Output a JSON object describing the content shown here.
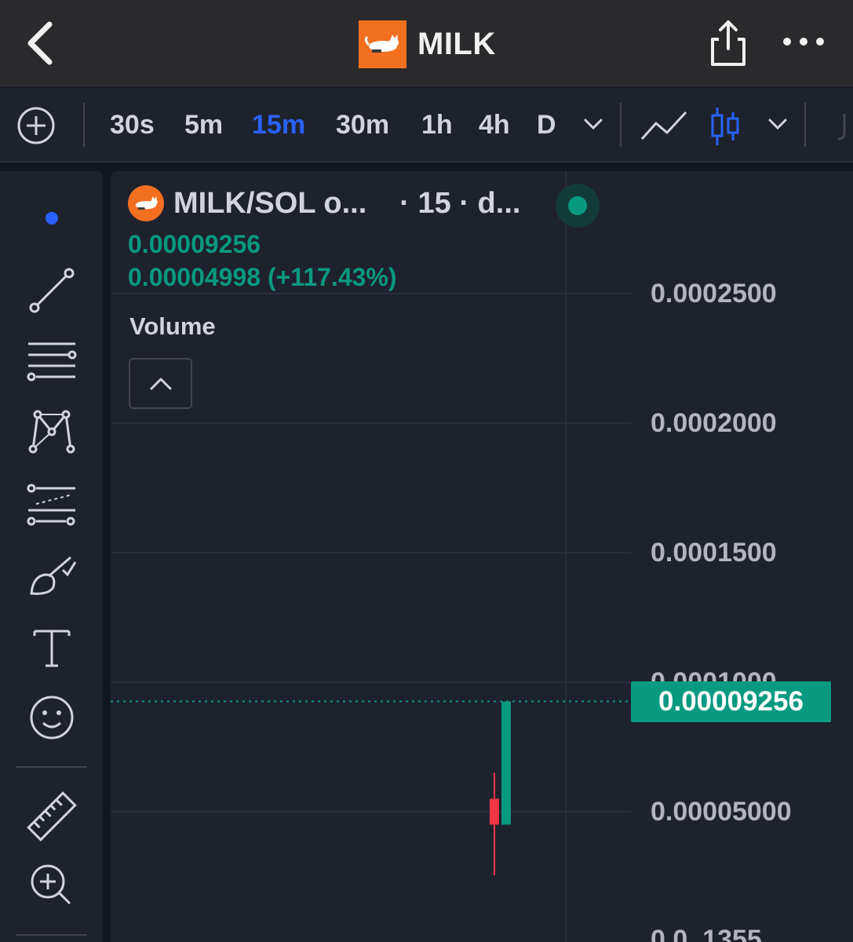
{
  "header": {
    "title": "MILK",
    "back_icon": "chevron-left-icon",
    "share_icon": "share-icon",
    "more_icon": "more-horizontal-icon"
  },
  "toolbar": {
    "timeframes": [
      {
        "label": "30s",
        "active": false
      },
      {
        "label": "5m",
        "active": false
      },
      {
        "label": "15m",
        "active": true
      },
      {
        "label": "30m",
        "active": false
      },
      {
        "label": "1h",
        "active": false
      },
      {
        "label": "4h",
        "active": false
      },
      {
        "label": "D",
        "active": false
      }
    ],
    "accent": "#2962ff"
  },
  "legend": {
    "symbol": "MILK/SOL o...",
    "info": "· 15 · d...",
    "last_price": "0.00009256",
    "change": "0.00004998 (+117.43%)"
  },
  "volume": {
    "label": "Volume"
  },
  "price_axis": {
    "labels": [
      "0.0002500",
      "0.0002000",
      "0.0001500",
      "0.0001000",
      "0.00005000",
      "0.0_1355"
    ],
    "current_price": "0.00009256"
  },
  "colors": {
    "up": "#089981",
    "down": "#f23645",
    "background": "#1e222d",
    "brand": "#f37021"
  },
  "chart_data": {
    "type": "candlestick",
    "interval": "15m",
    "candles": [
      {
        "open": 5.5e-05,
        "high": 6.5e-05,
        "low": 2.55e-05,
        "close": 4.5e-05
      },
      {
        "open": 4.5e-05,
        "high": 9.256e-05,
        "low": 4.5e-05,
        "close": 9.256e-05
      }
    ],
    "ylim": [
      0.0,
      0.000262
    ]
  }
}
